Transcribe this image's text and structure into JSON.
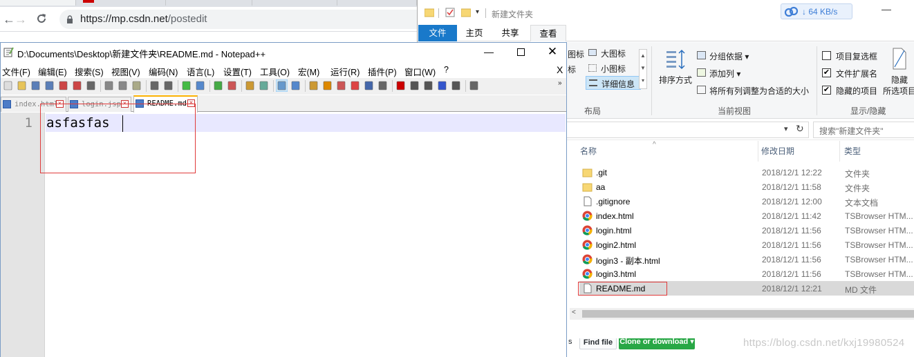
{
  "browser": {
    "url_host": "https://mp.csdn.net",
    "url_path": "/postedit",
    "find_file": "Find file",
    "clone_download": "Clone or download ▾",
    "watermark": "https://blog.csdn.net/kxj19980524"
  },
  "notepad": {
    "title": "D:\\Documents\\Desktop\\新建文件夹\\README.md - Notepad++",
    "menu": [
      "文件(F)",
      "编辑(E)",
      "搜索(S)",
      "视图(V)",
      "编码(N)",
      "语言(L)",
      "设置(T)",
      "工具(O)",
      "宏(M)",
      "运行(R)",
      "插件(P)",
      "窗口(W)",
      "?"
    ],
    "menu_close": "X",
    "tabs": [
      {
        "name": "index.html"
      },
      {
        "name": "login.jsp"
      },
      {
        "name": "README.md"
      }
    ],
    "line_number": "1",
    "content": "asfasfas"
  },
  "explorer": {
    "title": "新建文件夹",
    "speed": "64 KB/s",
    "ribbon_tabs": [
      "文件",
      "主页",
      "共享",
      "查看"
    ],
    "layout": {
      "large_partial": "图标",
      "medium_partial": "标",
      "large_icons": "大图标",
      "small_icons": "小图标",
      "details": "详细信息",
      "group": "布局"
    },
    "current_view": {
      "sort": "排序方式",
      "group_by": "分组依据 ▾",
      "add_columns": "添加列 ▾",
      "fit_columns": "将所有列调整为合适的大小",
      "group": "当前视图"
    },
    "show_hide": {
      "item_checkboxes": "项目复选框",
      "file_extensions": "文件扩展名",
      "hidden_items": "隐藏的项目",
      "hide_btn": "隐藏",
      "hide_selected": "所选项目",
      "group": "显示/隐藏"
    },
    "search_placeholder": "搜索\"新建文件夹\"",
    "columns": {
      "name": "名称",
      "date": "修改日期",
      "type": "类型"
    },
    "files": [
      {
        "name": ".git",
        "date": "2018/12/1 12:22",
        "type": "文件夹",
        "icon": "folder-icon"
      },
      {
        "name": "aa",
        "date": "2018/12/1 11:58",
        "type": "文件夹",
        "icon": "folder-icon"
      },
      {
        "name": ".gitignore",
        "date": "2018/12/1 12:00",
        "type": "文本文档",
        "icon": "text-file-icon"
      },
      {
        "name": "index.html",
        "date": "2018/12/1 11:42",
        "type": "TSBrowser HTM...",
        "icon": "chrome-icon"
      },
      {
        "name": "login.html",
        "date": "2018/12/1 11:56",
        "type": "TSBrowser HTM...",
        "icon": "chrome-icon"
      },
      {
        "name": "login2.html",
        "date": "2018/12/1 11:56",
        "type": "TSBrowser HTM...",
        "icon": "chrome-icon"
      },
      {
        "name": "login3 - 副本.html",
        "date": "2018/12/1 11:56",
        "type": "TSBrowser HTM...",
        "icon": "chrome-icon"
      },
      {
        "name": "login3.html",
        "date": "2018/12/1 11:56",
        "type": "TSBrowser HTM...",
        "icon": "chrome-icon"
      },
      {
        "name": "README.md",
        "date": "2018/12/1 12:21",
        "type": "MD 文件",
        "icon": "text-file-icon"
      }
    ]
  },
  "colors": {
    "accent_blue": "#1979ca",
    "highlight_red": "#e03a3a",
    "github_green": "#28a745"
  }
}
